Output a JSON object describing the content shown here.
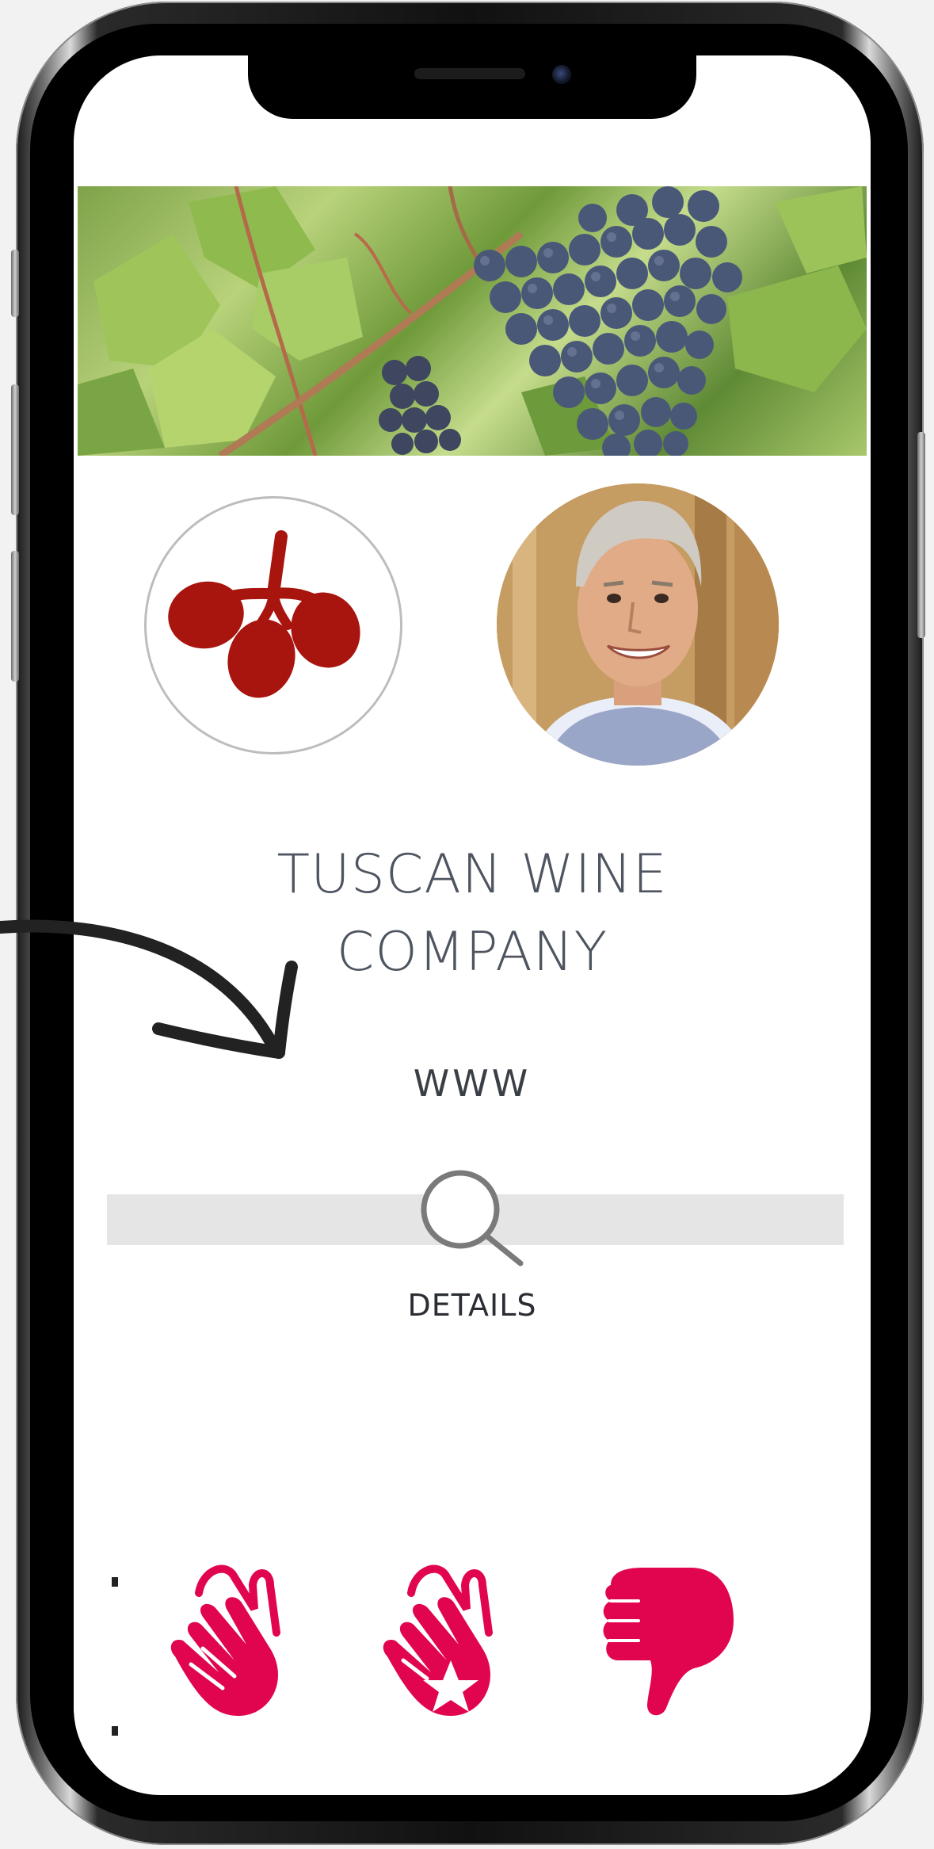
{
  "company": {
    "name_line1": "TUSCAN WINE",
    "name_line2": "COMPANY",
    "website": "WWW"
  },
  "search": {
    "details_label": "DETAILS"
  },
  "icons": {
    "logo": "grape-logo-icon",
    "avatar": "person-photo",
    "search": "magnifier-icon",
    "reactions": [
      "clap-icon",
      "clap-star-icon",
      "thumbs-down-icon"
    ]
  },
  "colors": {
    "logo_red": "#a8140e",
    "reaction_pink": "#e0054e",
    "title_gray": "#4e5560",
    "search_bar": "#e5e5e5"
  }
}
